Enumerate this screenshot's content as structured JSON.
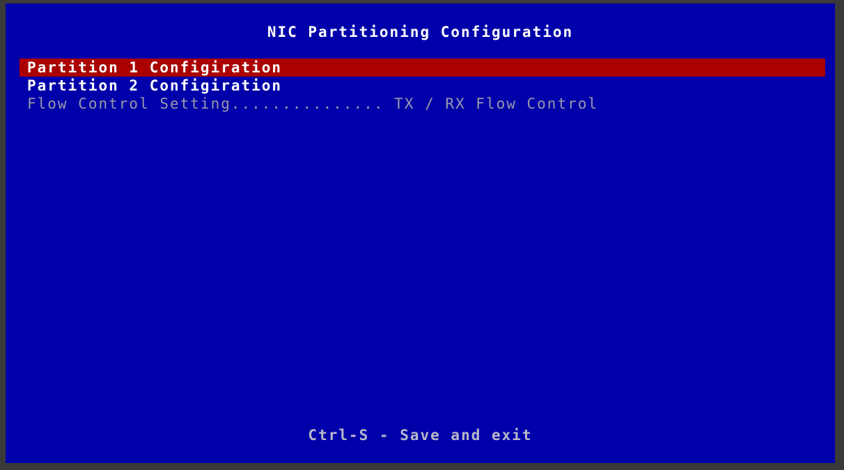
{
  "screen": {
    "title": "NIC Partitioning Configuration",
    "footer": "Ctrl-S - Save and exit"
  },
  "menu": {
    "items": [
      {
        "label": "Partition 1 Configiration",
        "state": "selected"
      },
      {
        "label": "Partition 2 Configiration",
        "state": "normal"
      },
      {
        "label": "Flow Control Setting............... TX / RX Flow Control",
        "state": "disabled"
      }
    ]
  },
  "colors": {
    "background": "#0000aa",
    "selection": "#aa0000",
    "text": "#ffffff",
    "dimmed_text": "#9a9aaa",
    "frame": "#3a3a3a"
  }
}
